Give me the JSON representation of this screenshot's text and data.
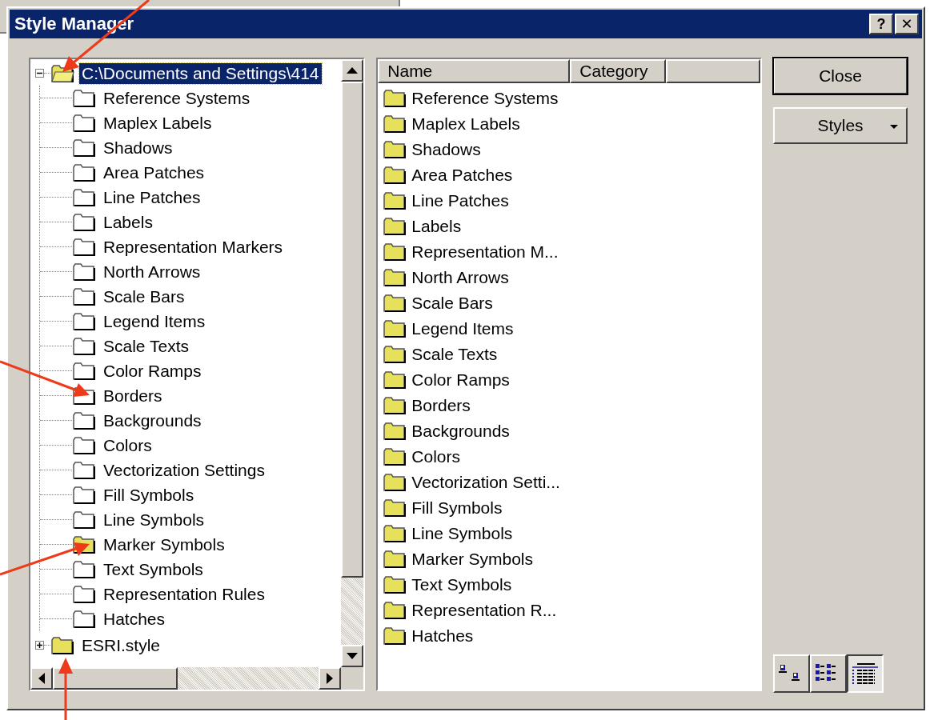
{
  "window": {
    "title": "Style Manager",
    "help_button": "?",
    "close_button": "✕"
  },
  "tree": [
    {
      "label": "C:\\Documents and Settings\\414",
      "expanded": true,
      "selected": true,
      "children": [
        {
          "label": "Reference Systems",
          "filled": false
        },
        {
          "label": "Maplex Labels",
          "filled": false
        },
        {
          "label": "Shadows",
          "filled": false
        },
        {
          "label": "Area Patches",
          "filled": false
        },
        {
          "label": "Line Patches",
          "filled": false
        },
        {
          "label": "Labels",
          "filled": false
        },
        {
          "label": "Representation Markers",
          "filled": false
        },
        {
          "label": "North Arrows",
          "filled": false
        },
        {
          "label": "Scale Bars",
          "filled": false
        },
        {
          "label": "Legend Items",
          "filled": false
        },
        {
          "label": "Scale Texts",
          "filled": false
        },
        {
          "label": "Color Ramps",
          "filled": false
        },
        {
          "label": "Borders",
          "filled": false
        },
        {
          "label": "Backgrounds",
          "filled": false
        },
        {
          "label": "Colors",
          "filled": false
        },
        {
          "label": "Vectorization Settings",
          "filled": false
        },
        {
          "label": "Fill Symbols",
          "filled": false
        },
        {
          "label": "Line Symbols",
          "filled": false
        },
        {
          "label": "Marker Symbols",
          "filled": true
        },
        {
          "label": "Text Symbols",
          "filled": false
        },
        {
          "label": "Representation Rules",
          "filled": false
        },
        {
          "label": "Hatches",
          "filled": false
        }
      ]
    },
    {
      "label": "ESRI.style",
      "expanded": false,
      "selected": false
    }
  ],
  "list": {
    "columns": [
      "Name",
      "Category"
    ],
    "items": [
      {
        "name": "Reference Systems",
        "filled": true
      },
      {
        "name": "Maplex Labels",
        "filled": true
      },
      {
        "name": "Shadows",
        "filled": true
      },
      {
        "name": "Area Patches",
        "filled": true
      },
      {
        "name": "Line Patches",
        "filled": true
      },
      {
        "name": "Labels",
        "filled": true
      },
      {
        "name": "Representation M...",
        "filled": true
      },
      {
        "name": "North Arrows",
        "filled": true
      },
      {
        "name": "Scale Bars",
        "filled": true
      },
      {
        "name": "Legend Items",
        "filled": true
      },
      {
        "name": "Scale Texts",
        "filled": true
      },
      {
        "name": "Color Ramps",
        "filled": true
      },
      {
        "name": "Borders",
        "filled": true
      },
      {
        "name": "Backgrounds",
        "filled": true
      },
      {
        "name": "Colors",
        "filled": true
      },
      {
        "name": "Vectorization Setti...",
        "filled": true
      },
      {
        "name": "Fill Symbols",
        "filled": true
      },
      {
        "name": "Line Symbols",
        "filled": true
      },
      {
        "name": "Marker Symbols",
        "filled": true
      },
      {
        "name": "Text Symbols",
        "filled": true
      },
      {
        "name": "Representation R...",
        "filled": true
      },
      {
        "name": "Hatches",
        "filled": true
      }
    ]
  },
  "buttons": [
    {
      "label": "Close",
      "default": true,
      "kind": "plain"
    },
    {
      "label": "Styles",
      "default": false,
      "kind": "dropdown"
    }
  ],
  "view_buttons": [
    {
      "kind": "large-icons",
      "selected": false
    },
    {
      "kind": "list",
      "selected": false
    },
    {
      "kind": "details",
      "selected": true
    }
  ]
}
